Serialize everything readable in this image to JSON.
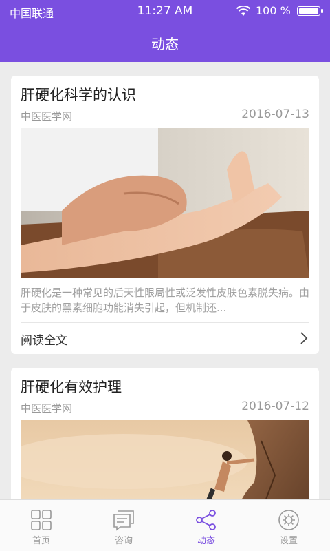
{
  "status_bar": {
    "carrier": "中国联通",
    "time": "11:27 AM",
    "battery": "100 %"
  },
  "header": {
    "title": "动态"
  },
  "accent_color": "#7a4fe0",
  "articles": [
    {
      "title": "肝硬化科学的认识",
      "source": "中医医学网",
      "date": "2016-07-13",
      "image": "doctor-checking-pulse-photo",
      "summary": "肝硬化是一种常见的后天性限局性或泛发性皮肤色素脱失病。由于皮肤的黑素细胞功能消失引起，但机制还...",
      "read_more": "阅读全文"
    },
    {
      "title": "肝硬化有效护理",
      "source": "中医医学网",
      "date": "2016-07-12",
      "image": "rock-climber-sunset-photo"
    }
  ],
  "tabs": [
    {
      "label": "首页",
      "icon": "grid-icon"
    },
    {
      "label": "咨询",
      "icon": "chat-icon"
    },
    {
      "label": "动态",
      "icon": "share-icon",
      "active": true
    },
    {
      "label": "设置",
      "icon": "settings-icon"
    }
  ]
}
